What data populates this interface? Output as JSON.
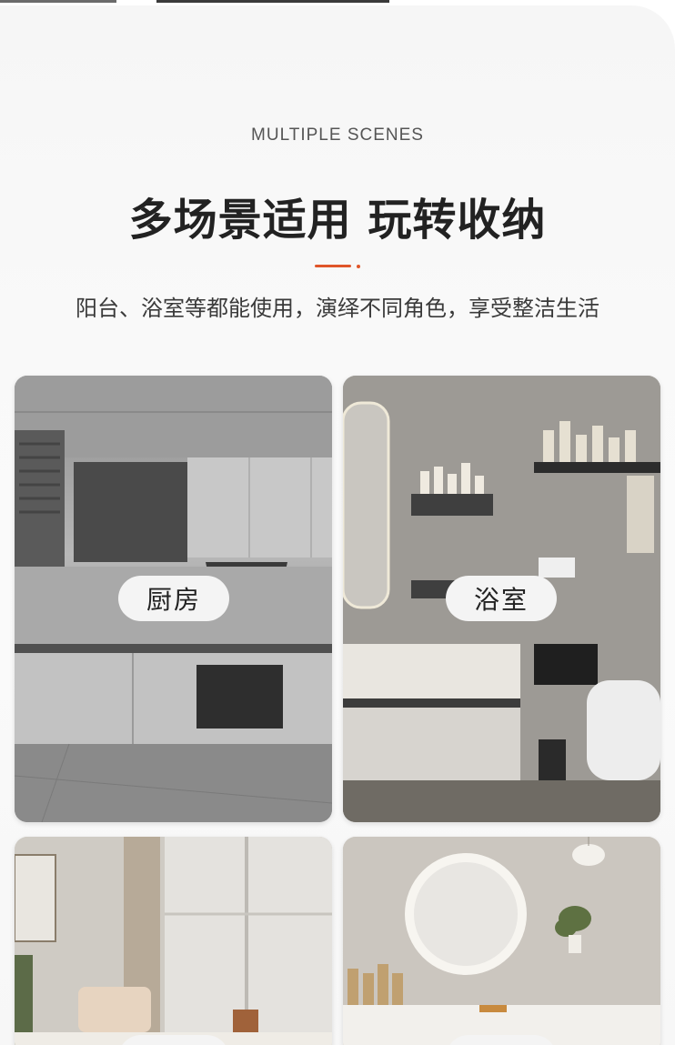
{
  "header": {
    "kicker": "MULTIPLE SCENES",
    "title": "多场景适用 玩转收纳",
    "subtitle": "阳台、浴室等都能使用，演绎不同角色，享受整洁生活"
  },
  "colors": {
    "accent": "#e0562a",
    "pill_bg": "#f4f4f4"
  },
  "scenes": [
    {
      "label": "厨房",
      "image": "kitchen-photo"
    },
    {
      "label": "浴室",
      "image": "bathroom-photo"
    },
    {
      "label": "",
      "image": "living-room-photo"
    },
    {
      "label": "",
      "image": "vanity-photo"
    }
  ]
}
